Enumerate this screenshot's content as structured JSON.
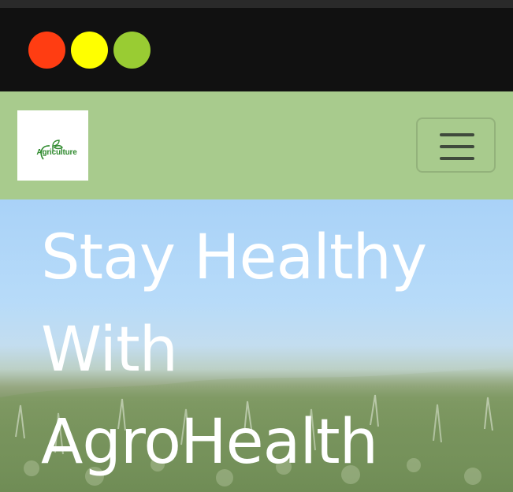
{
  "colors": {
    "top_strip": "#2a2a2a",
    "chrome_bar": "#111111",
    "dot_red": "#ff3d12",
    "dot_yellow": "#ffff00",
    "dot_green": "#99cc33",
    "navbar_bg": "#a8cb8d",
    "logo_green": "#2f8a2e",
    "hero_text": "#ffffff"
  },
  "window_controls": {
    "close_icon": "red-circle",
    "minimize_icon": "yellow-circle",
    "maximize_icon": "green-circle"
  },
  "navbar": {
    "logo_text": "Agriculture",
    "logo_icon": "leaf-sprout-icon",
    "menu_icon": "hamburger-menu-icon"
  },
  "hero": {
    "title_line1": "Stay Healthy",
    "title_line2": "With",
    "title_line3": "AgroHealth"
  }
}
